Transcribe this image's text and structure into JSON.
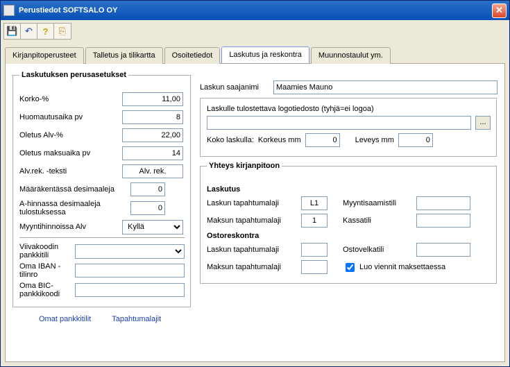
{
  "window": {
    "title": "Perustiedot   SOFTSALO OY"
  },
  "tabs": {
    "t0": "Kirjanpitoperusteet",
    "t1": "Talletus ja tilikartta",
    "t2": "Osoitetiedot",
    "t3": "Laskutus ja reskontra",
    "t4": "Muunnostaulut ym."
  },
  "left": {
    "heading": "Laskutuksen perusasetukset",
    "korko_label": "Korko-%",
    "korko": "11,00",
    "huomautus_label": "Huomautusaika pv",
    "huomautus": "8",
    "oletusalv_label": "Oletus Alv-%",
    "oletusalv": "22,00",
    "maksuaika_label": "Oletus maksuaika pv",
    "maksuaika": "14",
    "alvrek_label": "Alv.rek. -teksti",
    "alvrek": "Alv. rek.",
    "maara_label": "Määräkentässä desimaaleja",
    "maara": "0",
    "ahinta_label": "A-hinnassa desimaaleja tulostuksessa",
    "ahinta": "0",
    "myyntialv_label": "Myyntihinnoissa Alv",
    "myyntialv": "Kyllä",
    "viivakoodi_label": "Viivakoodin pankkitili",
    "oma_iban_label": "Oma IBAN -tilinro",
    "oma_bic_label": "Oma BIC-pankkikoodi"
  },
  "right": {
    "saajanimi_label": "Laskun saajanimi",
    "saajanimi": "Maamies Mauno",
    "logo_label": "Laskulle tulostettava logotiedosto (tyhjä=ei logoa)",
    "logo": "",
    "koko_label": "Koko laskulla:",
    "korkeus_label": "Korkeus mm",
    "korkeus": "0",
    "leveys_label": "Leveys mm",
    "leveys": "0"
  },
  "yhteys": {
    "heading": "Yhteys kirjanpitoon",
    "laskutus_title": "Laskutus",
    "laji_label": "Laskun tapahtumalaji",
    "laji": "L1",
    "myyntisaamis_label": "Myyntisaamistili",
    "myyntisaamis": "",
    "maksun_label": "Maksun tapahtumalaji",
    "maksun": "1",
    "kassa_label": "Kassatili",
    "kassa": "",
    "ostoreskontra_title": "Ostoreskontra",
    "osto_laji_label": "Laskun tapahtumalaji",
    "osto_laji": "",
    "ostovelka_label": "Ostovelkatili",
    "ostovelka": "",
    "osto_maksun_label": "Maksun tapahtumalaji",
    "osto_maksun": "",
    "luoviennit_label": "Luo viennit maksettaessa",
    "luoviennit_checked": true
  },
  "links": {
    "pankkitilit": "Omat pankkitilit",
    "tapahtumalajit": "Tapahtumalajit"
  }
}
